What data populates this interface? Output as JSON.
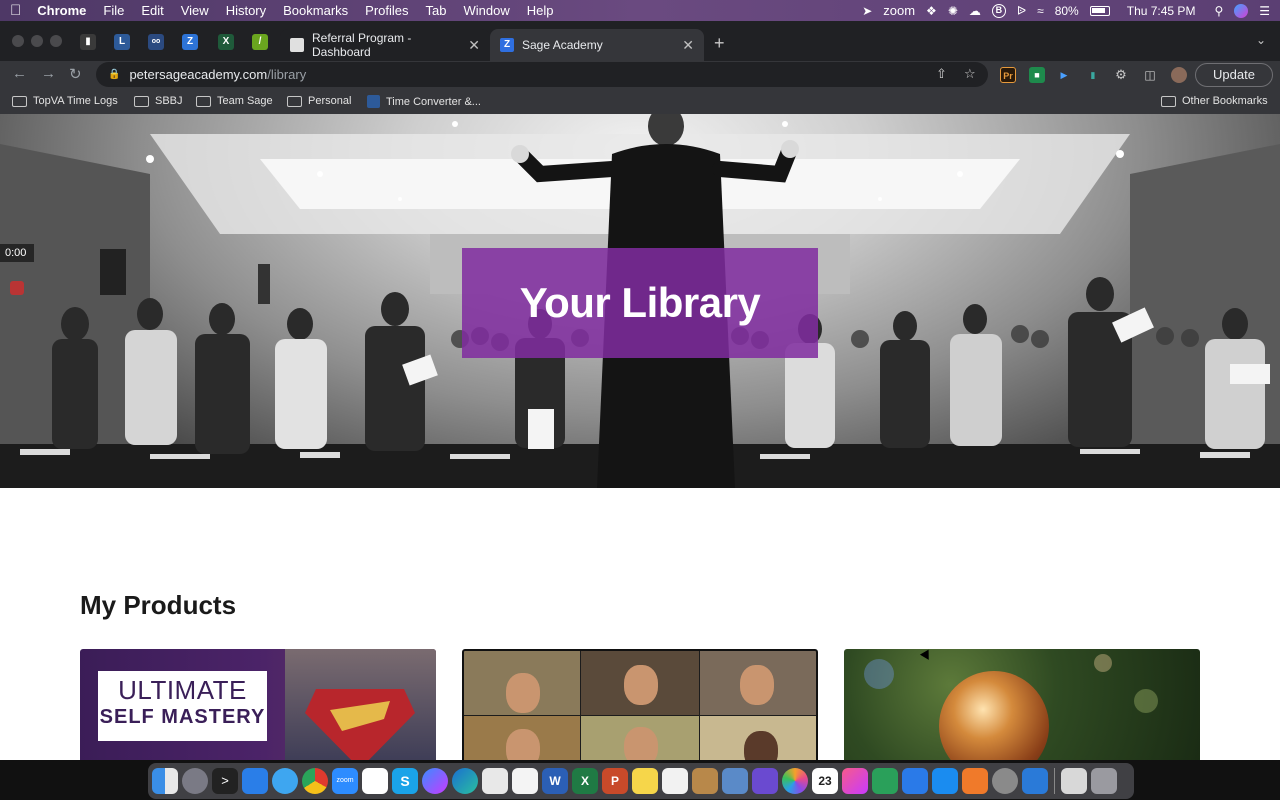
{
  "menubar": {
    "app_name": "Chrome",
    "items": [
      "File",
      "Edit",
      "View",
      "History",
      "Bookmarks",
      "Profiles",
      "Tab",
      "Window",
      "Help"
    ],
    "zoom_label": "zoom",
    "battery": "80%",
    "clock": "Thu 7:45 PM"
  },
  "tabs": [
    {
      "title": "Referral Program - Dashboard",
      "active": false
    },
    {
      "title": "Sage Academy",
      "active": true
    }
  ],
  "address": {
    "domain": "petersageacademy.com",
    "path": "/library"
  },
  "toolbar": {
    "update_label": "Update"
  },
  "bookmarks": {
    "items": [
      "TopVA Time Logs",
      "SBBJ",
      "Team Sage",
      "Personal",
      "Time Converter &..."
    ],
    "other": "Other Bookmarks"
  },
  "recording": {
    "timecode": "0:00"
  },
  "hero": {
    "title": "Your Library"
  },
  "library": {
    "section_title": "My Products",
    "cards": [
      {
        "logo_line1": "ULTIMATE",
        "logo_line2": "SELF MASTERY"
      },
      {},
      {}
    ]
  },
  "colors": {
    "brand_purple": "#802ca0",
    "chrome_dark": "#202124",
    "chrome_toolbar": "#35363a"
  },
  "icons": {
    "menubar": [
      "apple-icon",
      "location-icon",
      "dropbox-icon",
      "settings-icon",
      "cloud-icon",
      "bitcoin-icon",
      "bluetooth-icon",
      "wifi-icon",
      "battery-icon",
      "search-icon",
      "siri-icon",
      "control-center-icon"
    ],
    "dock": [
      "finder-icon",
      "launchpad-icon",
      "terminal-icon",
      "app-store-icon",
      "safari-icon",
      "chrome-icon",
      "zoom-icon",
      "slack-icon",
      "skype-icon",
      "messenger-icon",
      "edge-icon",
      "preview-icon",
      "textedit-icon",
      "word-icon",
      "excel-icon",
      "powerpoint-icon",
      "notes-icon",
      "reminders-icon",
      "notebook-icon",
      "image-capture-icon",
      "imovie-icon",
      "photos-icon",
      "calendar-icon",
      "music-icon",
      "numbers-icon",
      "keynote-icon",
      "app-store-icon",
      "books-icon",
      "system-preferences-icon",
      "onedrive-icon",
      "music-file-icon",
      "trash-icon"
    ]
  }
}
